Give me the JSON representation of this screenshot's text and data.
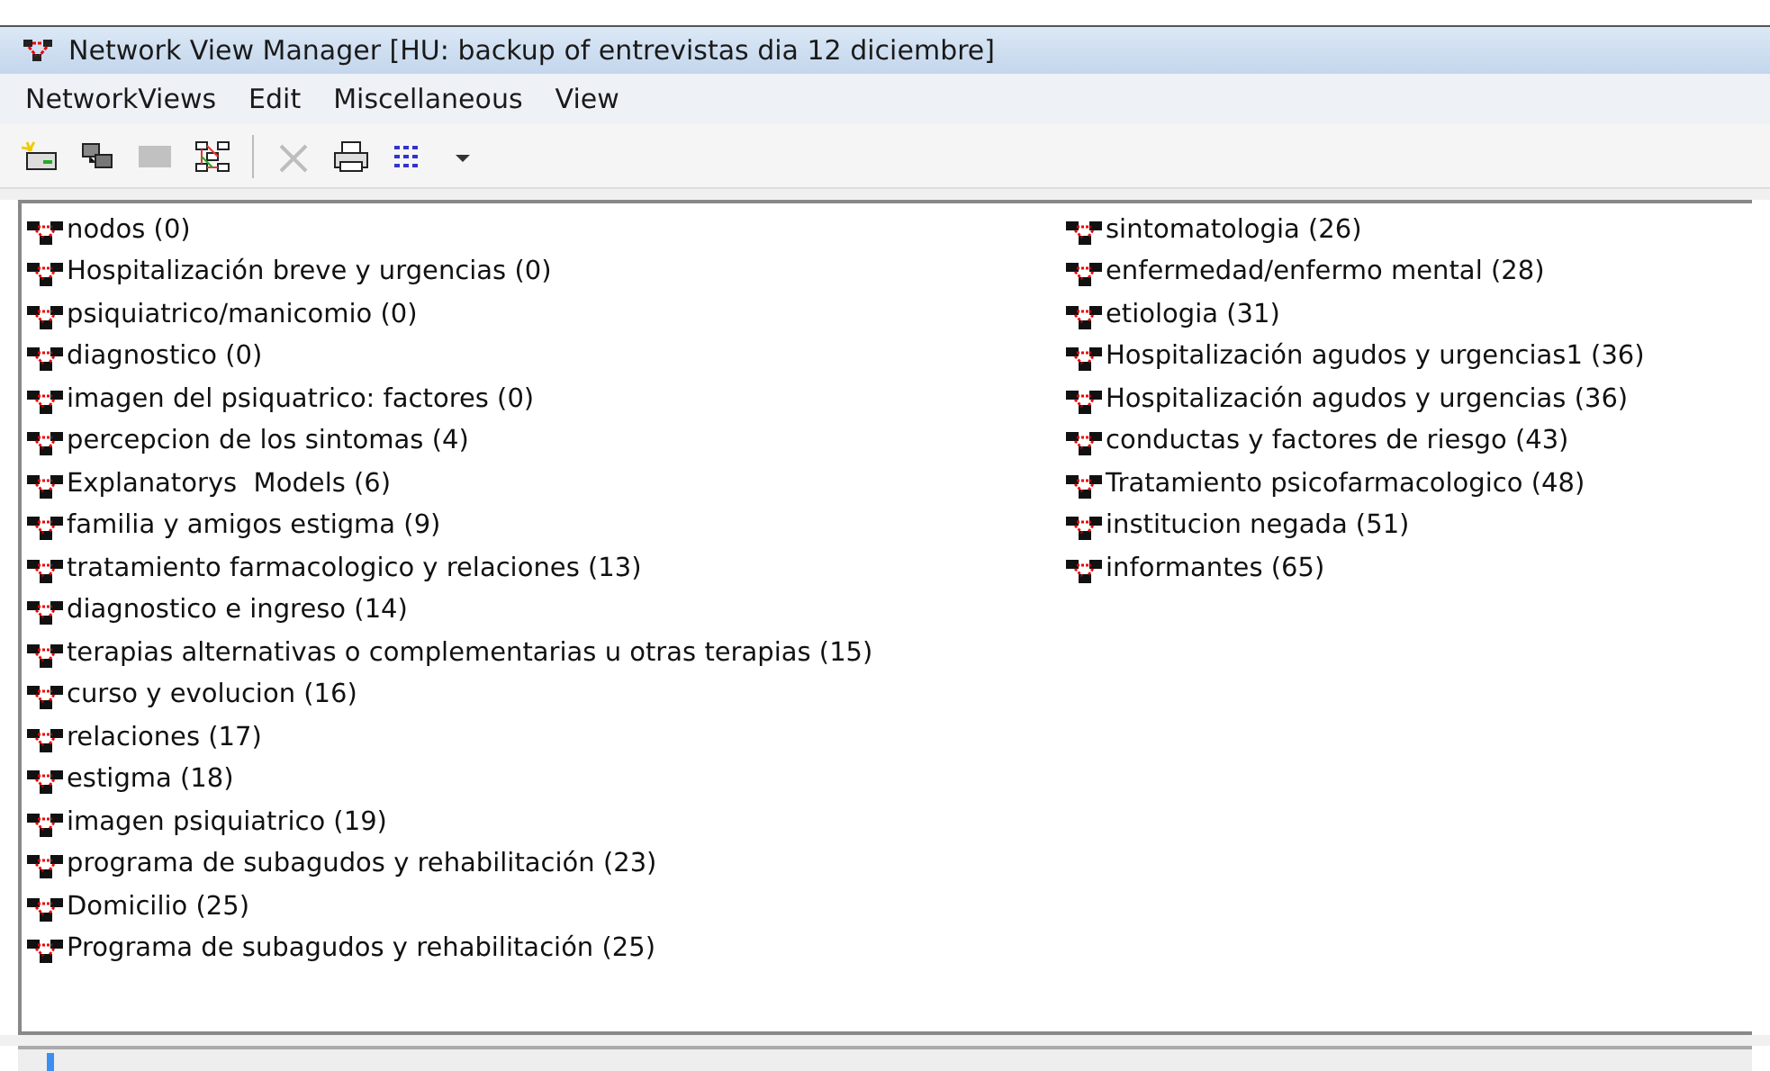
{
  "window": {
    "title": "Network View Manager [HU: backup of entrevistas dia 12 diciembre]"
  },
  "menu": [
    "NetworkViews",
    "Edit",
    "Miscellaneous",
    "View"
  ],
  "toolbar": [
    {
      "kind": "new",
      "disabled": false
    },
    {
      "kind": "windows",
      "disabled": false
    },
    {
      "kind": "blank",
      "disabled": true
    },
    {
      "kind": "network",
      "disabled": false
    },
    {
      "kind": "separator"
    },
    {
      "kind": "delete",
      "disabled": true
    },
    {
      "kind": "print",
      "disabled": false
    },
    {
      "kind": "list",
      "disabled": false
    },
    {
      "kind": "dropdown",
      "disabled": false
    }
  ],
  "views": {
    "columns": [
      {
        "items": [
          "nodos (0)",
          "Hospitalización breve y urgencias (0)",
          "psiquiatrico/manicomio (0)",
          "diagnostico (0)",
          "imagen del psiquatrico: factores (0)",
          "percepcion de los sintomas (4)",
          "Explanatorys  Models (6)",
          "familia y amigos estigma (9)",
          "tratamiento farmacologico y relaciones (13)",
          "diagnostico e ingreso (14)",
          "terapias alternativas o complementarias u otras terapias (15)",
          "curso y evolucion (16)",
          "relaciones (17)",
          "estigma (18)",
          "imagen psiquiatrico (19)",
          "programa de subagudos y rehabilitación (23)",
          "Domicilio (25)",
          "Programa de subagudos y rehabilitación (25)"
        ]
      },
      {
        "items": [
          "sintomatologia (26)",
          "enfermedad/enfermo mental (28)",
          "etiologia (31)",
          "Hospitalización agudos y urgencias1 (36)",
          "Hospitalización agudos y urgencias (36)",
          "conductas y factores de riesgo (43)",
          "Tratamiento psicofarmacologico (48)",
          "institucion negada (51)",
          "informantes (65)"
        ]
      }
    ]
  }
}
